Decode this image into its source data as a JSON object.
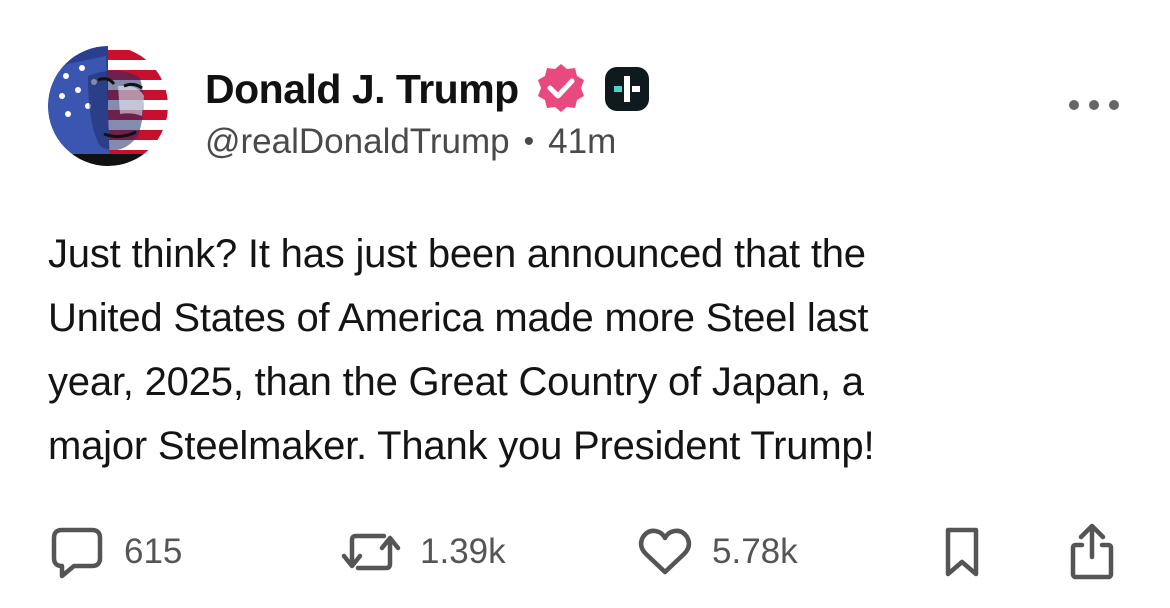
{
  "author": {
    "display_name": "Donald J. Trump",
    "handle": "@realDonaldTrump",
    "separator": "•",
    "timestamp": "41m",
    "verified_icon": "verified-badge-icon",
    "extra_badge_icon": "plus-badge-icon",
    "avatar_icon": "avatar-flag-portrait"
  },
  "post": {
    "text_lines": [
      "Just think? It has just been announced that the",
      "United States of America made more Steel last",
      "year, 2025, than the Great Country of Japan, a",
      "major Steelmaker. Thank you President Trump!"
    ]
  },
  "actions": {
    "reply": {
      "icon": "comment-icon",
      "count": "615"
    },
    "repost": {
      "icon": "repost-icon",
      "count": "1.39k"
    },
    "like": {
      "icon": "heart-icon",
      "count": "5.78k"
    },
    "bookmark": {
      "icon": "bookmark-icon"
    },
    "share": {
      "icon": "share-icon"
    },
    "more": {
      "icon": "more-dots-icon"
    }
  },
  "colors": {
    "verified_pink": "#e8497f",
    "plus_badge_bg": "#0f1a1e",
    "plus_badge_accent": "#4fd1c5",
    "text_primary": "#111111",
    "text_secondary": "#4a4a4a",
    "icon_gray": "#555555"
  }
}
